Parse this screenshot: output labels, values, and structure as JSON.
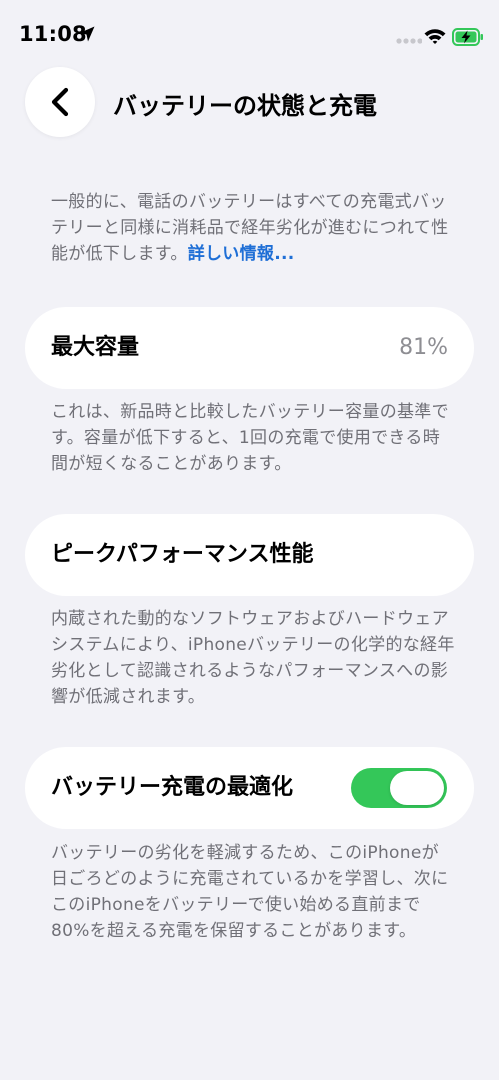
{
  "status_bar": {
    "time": "11:08"
  },
  "header": {
    "title": "バッテリーの状態と充電"
  },
  "intro": {
    "text": "一般的に、電話のバッテリーはすべての充電式バッテリーと同様に消耗品で経年劣化が進むにつれて性能が低下します。",
    "link": "詳しい情報..."
  },
  "max_capacity": {
    "label": "最大容量",
    "value": "81%",
    "description": "これは、新品時と比較したバッテリー容量の基準です。容量が低下すると、1回の充電で使用できる時間が短くなることがあります。"
  },
  "peak_performance": {
    "label": "ピークパフォーマンス性能",
    "description": "内蔵された動的なソフトウェアおよびハードウェアシステムにより、iPhoneバッテリーの化学的な経年劣化として認識されるようなパフォーマンスへの影響が低減されます。"
  },
  "optimized_charging": {
    "label": "バッテリー充電の最適化",
    "enabled": true,
    "description": "バッテリーの劣化を軽減するため、このiPhoneが日ごろどのように充電されているかを学習し、次にこのiPhoneをバッテリーで使い始める直前まで80%を超える充電を保留することがあります。"
  },
  "colors": {
    "background": "#f2f2f7",
    "link": "#1f6fd6",
    "toggle_on": "#34c759",
    "secondary_text": "#707077"
  }
}
